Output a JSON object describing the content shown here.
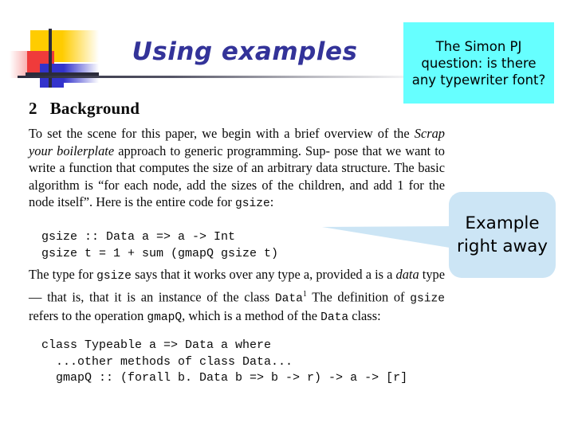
{
  "slide": {
    "title": "Using examples",
    "title_color": "#333399",
    "background": "#ffffff"
  },
  "decoration": {
    "yellow": "#ffcc00",
    "red": "#ef3b3b",
    "blue": "#3333cc",
    "line": "#2b2b3b"
  },
  "paper": {
    "section_number": "2",
    "section_title": "Background",
    "paragraph1": {
      "line1": "To set the scene for this paper, we begin with a brief overview of",
      "line2_pre": "the ",
      "line2_italic": "Scrap your boilerplate",
      "line2_post": " approach to generic programming. Sup-",
      "line3": "pose that we want to write a function that computes the size of an",
      "line4": "arbitrary data structure. The basic algorithm is “for each node, add",
      "line5": "the sizes of the children, and add 1 for the node itself”. Here is the",
      "line6_pre": "entire code for ",
      "line6_mono": "gsize",
      "line6_post": ":"
    },
    "code1": "gsize :: Data a => a -> Int\ngsize t = 1 + sum (gmapQ gsize t)",
    "paragraph2": {
      "line1_pre": "The type for ",
      "line1_mono": "gsize",
      "line1_post": " says that it works over any type a, provided a",
      "line2_pre": "is a ",
      "line2_italic": "data",
      "line2_mid": " type — that is, that it is an instance of the class ",
      "line2_mono": "Data",
      "line2_sup": "1",
      "line3_pre": "The definition of ",
      "line3_mono1": "gsize",
      "line3_mid": " refers to the operation ",
      "line3_mono2": "gmapQ",
      "line3_post": ", which is a",
      "line4_pre": "method of the ",
      "line4_mono": "Data",
      "line4_post": " class:"
    },
    "code2": "class Typeable a => Data a where\n  ...other methods of class Data...\n  gmapQ :: (forall b. Data b => b -> r) -> a -> [r]"
  },
  "annotations": {
    "cyan_note": {
      "text": "The Simon PJ question: is there any typewriter font?",
      "background": "#66ffff"
    },
    "callout": {
      "text": "Example right away",
      "background": "#cce5f5"
    }
  }
}
